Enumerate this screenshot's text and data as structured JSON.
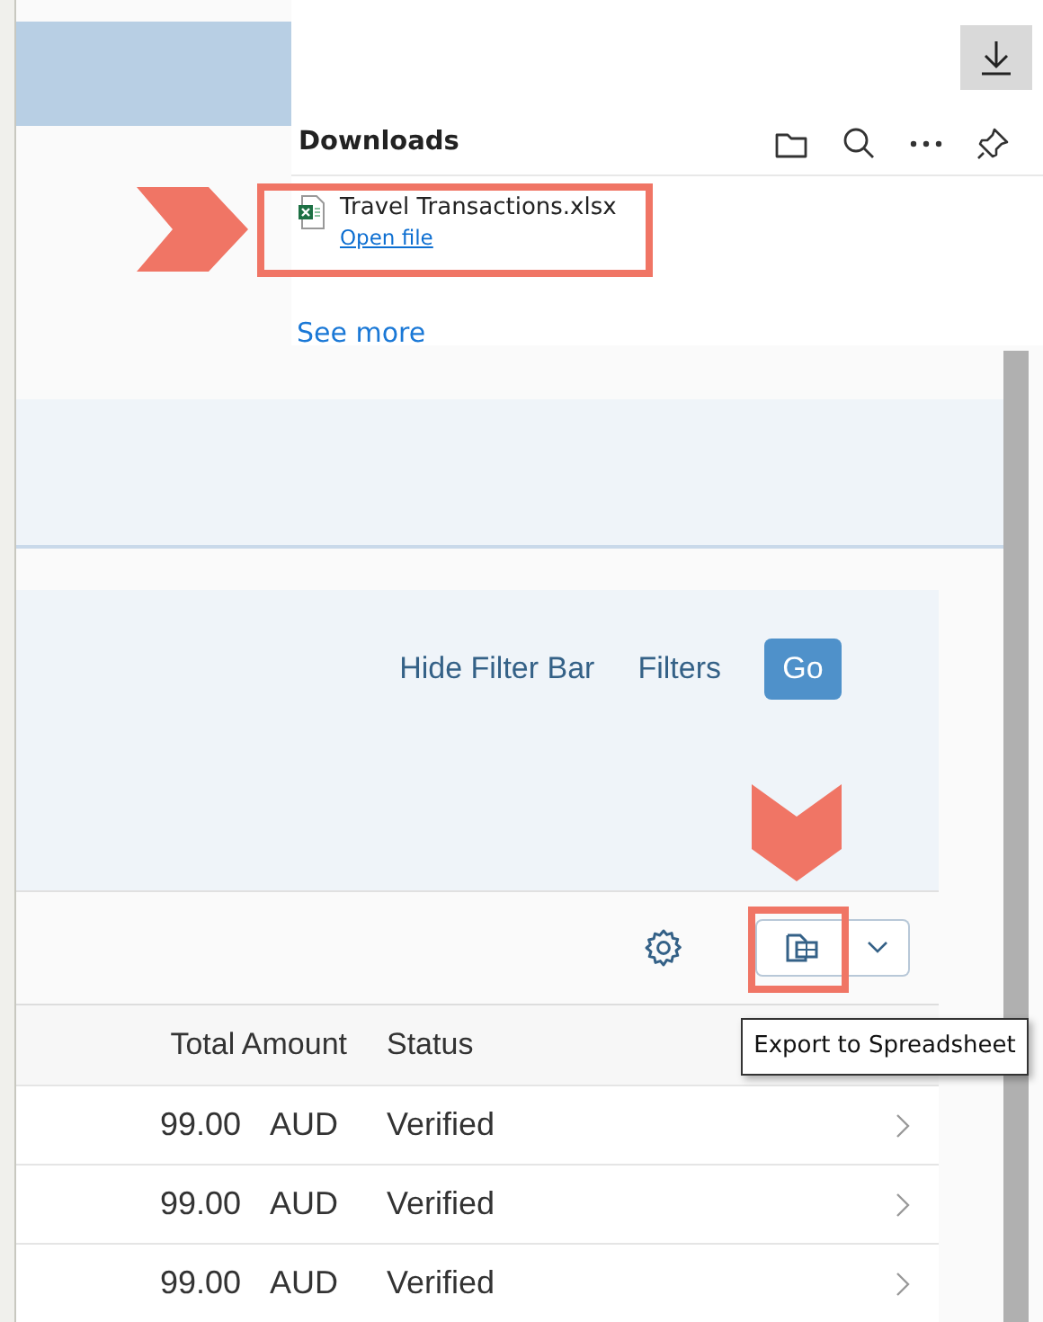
{
  "downloads_panel": {
    "title": "Downloads",
    "items": [
      {
        "file_name": "Travel Transactions.xlsx",
        "action": "Open file",
        "highlighted": true
      }
    ],
    "see_more": "See more"
  },
  "filter_bar": {
    "links": [
      "Hide Filter Bar",
      "Filters"
    ],
    "go_button": "Go"
  },
  "toolbar": {
    "export_highlighted": true,
    "tooltip": "Export to Spreadsheet"
  },
  "table": {
    "columns": [
      "Total Amount",
      "Status"
    ],
    "rows": [
      {
        "amount": "99.00",
        "currency": "AUD",
        "status": "Verified"
      },
      {
        "amount": "99.00",
        "currency": "AUD",
        "status": "Verified"
      },
      {
        "amount": "99.00",
        "currency": "AUD",
        "status": "Verified"
      }
    ]
  }
}
